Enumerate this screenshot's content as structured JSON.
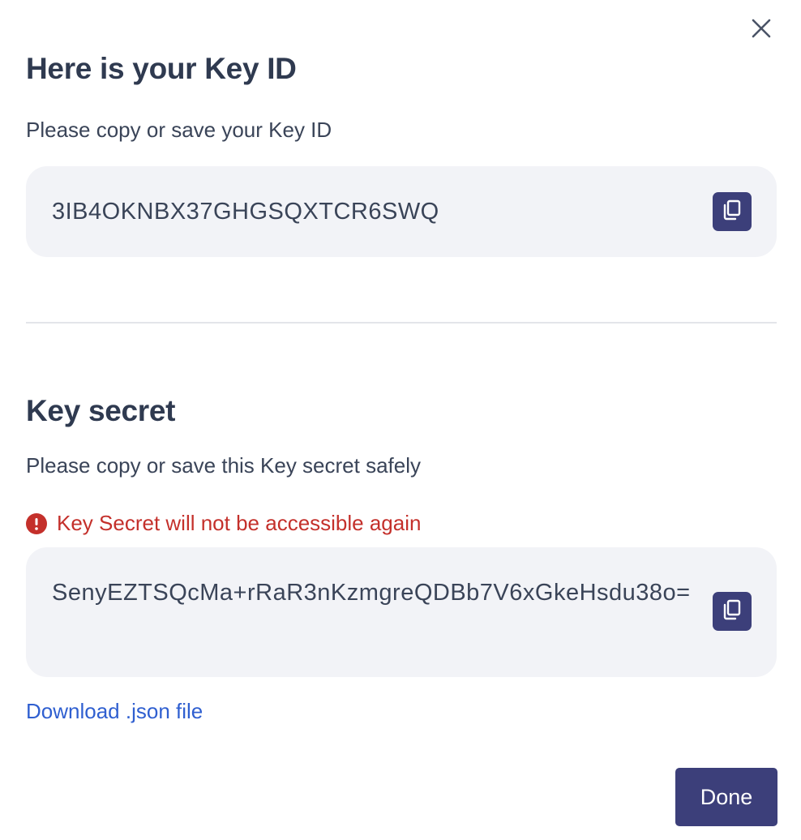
{
  "dialog": {
    "close_icon": "close-icon"
  },
  "key_id_section": {
    "title": "Here is your Key ID",
    "description": "Please copy or save your Key ID",
    "value": "3IB4OKNBX37GHGSQXTCR6SWQ",
    "copy_icon": "copy-icon"
  },
  "key_secret_section": {
    "title": "Key secret",
    "description": "Please copy or save this Key secret safely",
    "warning": "Key Secret will not be accessible again",
    "warning_icon": "alert-circle-icon",
    "value": "SenyEZTSQcMa+rRaR3nKzmgreQDBb7V6xGkeHsdu38o=",
    "copy_icon": "copy-icon"
  },
  "download_link": "Download .json file",
  "done_button": "Done",
  "colors": {
    "primary": "#3c3f7a",
    "warning": "#c4302b",
    "link": "#2f5fd0",
    "box_background": "#f2f3f7"
  }
}
